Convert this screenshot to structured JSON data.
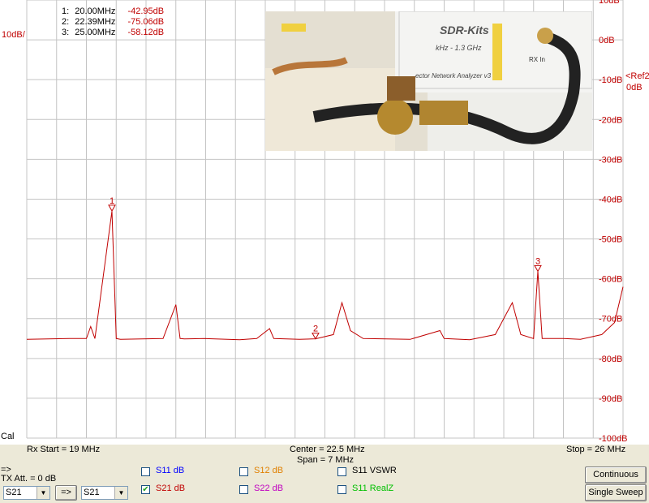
{
  "markers": [
    {
      "id": "1:",
      "freq": "20.00MHz",
      "level": "-42.95dB"
    },
    {
      "id": "2:",
      "freq": "22.39MHz",
      "level": "-75.06dB"
    },
    {
      "id": "3:",
      "freq": "25.00MHz",
      "level": "-58.12dB"
    }
  ],
  "scale_label": "10dB/",
  "ref_label": "<Ref2",
  "ref_value": "0dB",
  "cal_label": "Cal",
  "y_ticks": [
    "10dB",
    "0dB",
    "-10dB",
    "-20dB",
    "-30dB",
    "-40dB",
    "-50dB",
    "-60dB",
    "-70dB",
    "-80dB",
    "-90dB",
    "-100dB"
  ],
  "rx_start": "Rx Start = 19 MHz",
  "center": "Center = 22.5 MHz",
  "span": "Span = 7 MHz",
  "stop": "Stop = 26 MHz",
  "arrow_label": "=>",
  "tx_att": "TX Att.  = 0 dB",
  "left_select": "S21",
  "transfer_button": "=>",
  "right_select": "S21",
  "checkboxes": [
    {
      "label": "S11  dB",
      "checked": false,
      "color": "#0000ff"
    },
    {
      "label": "S21  dB",
      "checked": true,
      "color": "#c00000"
    },
    {
      "label": "S12  dB",
      "checked": false,
      "color": "#e08000"
    },
    {
      "label": "S22  dB",
      "checked": false,
      "color": "#c000c0"
    },
    {
      "label": "S11  VSWR",
      "checked": false,
      "color": "#000000"
    },
    {
      "label": "S11  RealZ",
      "checked": false,
      "color": "#00c000"
    }
  ],
  "continuous_button": "Continuous",
  "single_sweep_button": "Single Sweep",
  "photo": {
    "brand": "SDR-Kits",
    "range": "kHz - 1.3 GHz",
    "rx_in": "RX In",
    "device": "ector Network Analyzer v3"
  },
  "chart_data": {
    "type": "line",
    "xlabel": "",
    "ylabel": "",
    "xlim": [
      19,
      26
    ],
    "ylim": [
      -100,
      10
    ],
    "grid": true,
    "series": [
      {
        "color": "#c00000",
        "x": [
          19.0,
          19.5,
          19.7,
          19.75,
          19.8,
          20.0,
          20.05,
          20.1,
          20.6,
          20.75,
          20.8,
          20.85,
          21.1,
          21.5,
          21.7,
          21.85,
          21.9,
          22.2,
          22.39,
          22.6,
          22.7,
          22.8,
          22.95,
          23.5,
          23.85,
          23.9,
          24.2,
          24.5,
          24.65,
          24.7,
          24.8,
          24.95,
          25.0,
          25.05,
          25.3,
          25.5,
          25.75,
          25.9,
          26.0
        ],
        "y": [
          -75.2,
          -75,
          -75,
          -72,
          -75,
          -43,
          -75,
          -75.2,
          -75,
          -66.5,
          -75,
          -75.1,
          -75,
          -75.3,
          -75,
          -72.5,
          -75,
          -75.2,
          -75.06,
          -74,
          -66,
          -73,
          -75,
          -75.2,
          -73,
          -75,
          -75.3,
          -74,
          -68,
          -66,
          -74,
          -75,
          -58.12,
          -75,
          -75,
          -75.2,
          -74,
          -71,
          -62
        ]
      }
    ],
    "marker_points": [
      {
        "label": "1",
        "x": 20.0,
        "y": -42.95
      },
      {
        "label": "2",
        "x": 22.39,
        "y": -75.06
      },
      {
        "label": "3",
        "x": 25.0,
        "y": -58.12
      }
    ]
  }
}
